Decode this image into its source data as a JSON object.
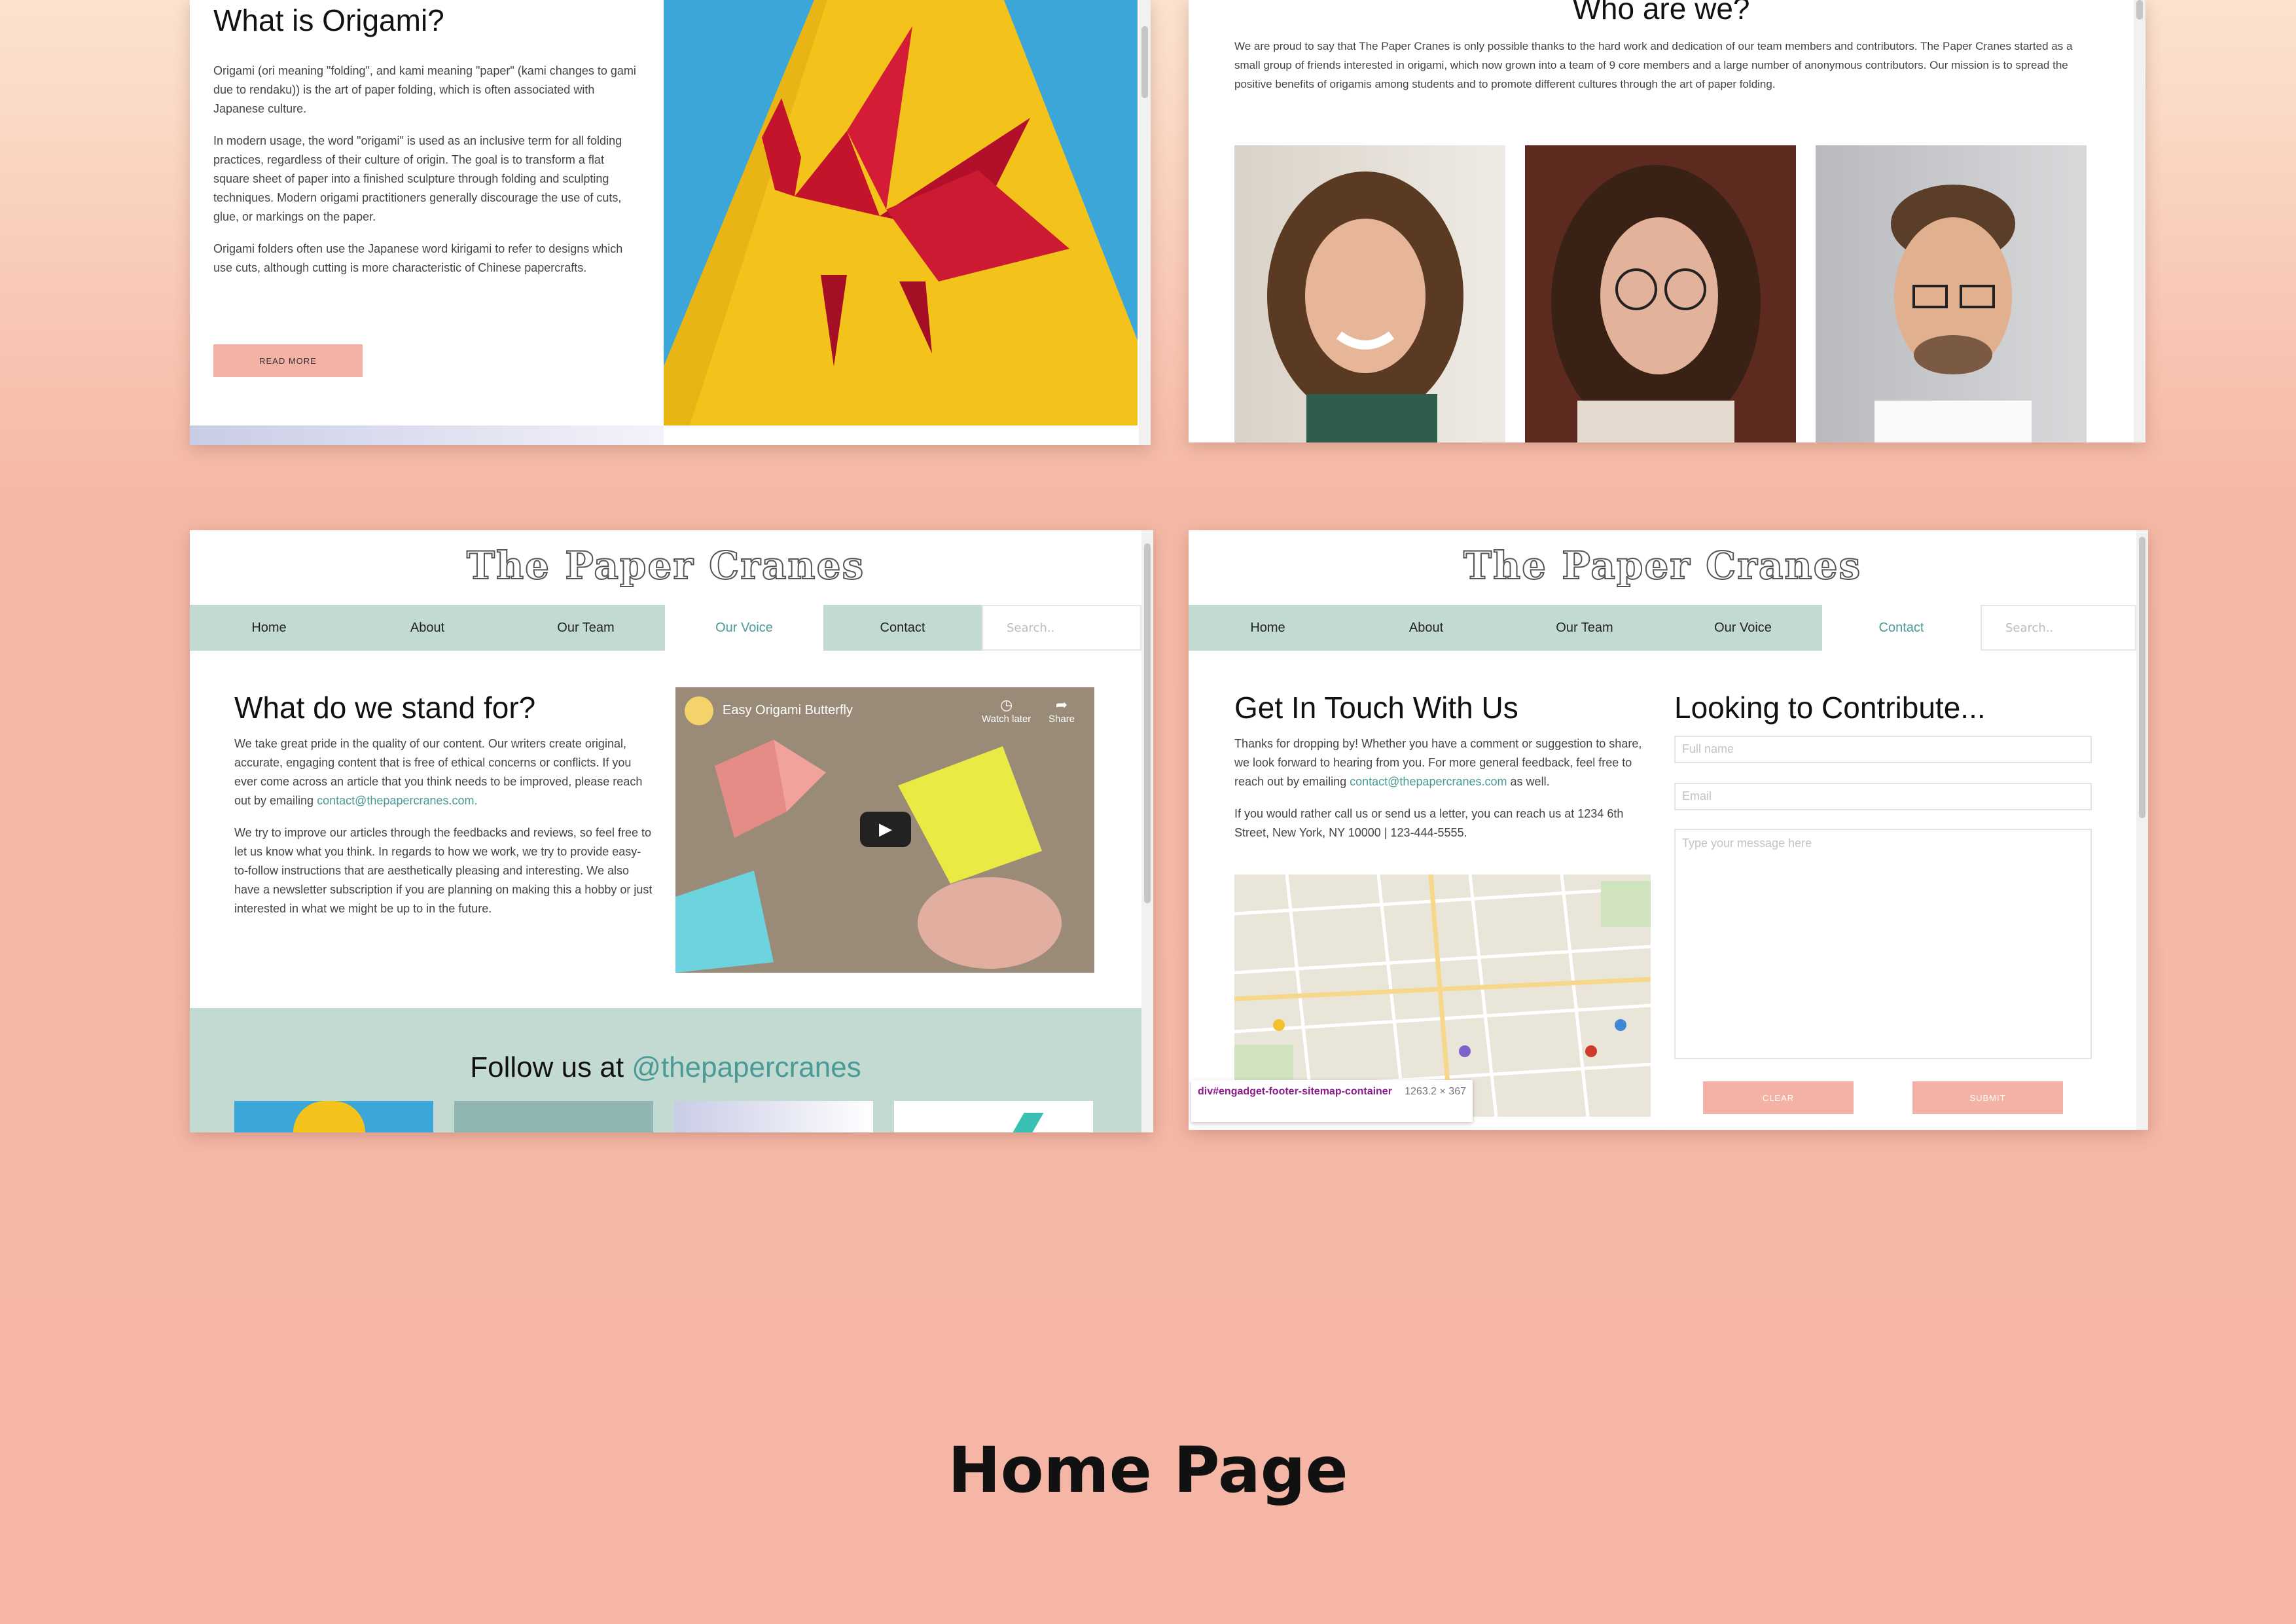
{
  "caption": "Home Page",
  "panel_about": {
    "title": "What is Origami?",
    "paragraphs": [
      "Origami (ori meaning \"folding\", and kami meaning \"paper\" (kami changes to gami due to rendaku)) is the art of paper folding, which is often associated with Japanese culture.",
      "In modern usage, the word \"origami\" is used as an inclusive term for all folding practices, regardless of their culture of origin. The goal is to transform a flat square sheet of paper into a finished sculpture through folding and sculpting techniques. Modern origami practitioners generally discourage the use of cuts, glue, or markings on the paper.",
      "Origami folders often use the Japanese word kirigami to refer to designs which use cuts, although cutting is more characteristic of Chinese papercrafts."
    ],
    "read_more": "READ MORE"
  },
  "panel_team": {
    "title": "Who are we?",
    "text": "We are proud to say that The Paper Cranes is only possible thanks to the hard work and dedication of our team members and contributors. The Paper Cranes started as a small group of friends interested in origami, which now grown into a team of 9 core members and a large number of anonymous contributors. Our mission is to spread the positive benefits of origamis among students and to promote different cultures through the art of paper folding."
  },
  "site": {
    "logo": "The Paper Cranes",
    "nav": [
      "Home",
      "About",
      "Our Team",
      "Our Voice",
      "Contact"
    ],
    "search_placeholder": "Search.."
  },
  "panel_voice": {
    "title": "What do we stand for?",
    "p1_pre": "We take great pride in the quality of our content. Our writers create original, accurate, engaging content that is free of ethical concerns or conflicts. If you ever come across an article that you think needs to be improved, please reach out by emailing",
    "p1_link": "contact@thepapercranes.com.",
    "p2": "We try to improve our articles through the feedbacks and reviews, so feel free to let us know what you think. In regards to how we work, we try to provide easy-to-follow instructions that are aesthetically pleasing and interesting. We also have a newsletter subscription if you are planning on making this a hobby or just interested in what we might be up to in the future.",
    "video_title": "Easy Origami Butterfly",
    "watch_later": "Watch later",
    "share": "Share",
    "follow_prefix": "Follow us at",
    "follow_handle": "@thepapercranes"
  },
  "panel_contact": {
    "title_left": "Get In Touch With Us",
    "p1_pre": "Thanks for dropping by! Whether you have a comment or suggestion to share, we look forward to hearing from you. For more general feedback, feel free to reach out by emailing",
    "p1_link": "contact@thepapercranes.com",
    "p1_post": "as well.",
    "p2": "If you would rather call us or send us a letter, you can reach us at 1234 6th Street, New York, NY 10000 | 123-444-5555.",
    "title_right": "Looking to Contribute...",
    "full_name_placeholder": "Full name",
    "email_placeholder": "Email",
    "message_placeholder": "Type your message here",
    "clear": "CLEAR",
    "submit": "SUBMIT",
    "tooltip_selector": "div#engadget-footer-sitemap-container",
    "tooltip_size": "1263.2 × 367"
  },
  "colors": {
    "accent": "#4a9a95",
    "nav_bg": "#c3dad3",
    "button": "#f3b2a5"
  }
}
